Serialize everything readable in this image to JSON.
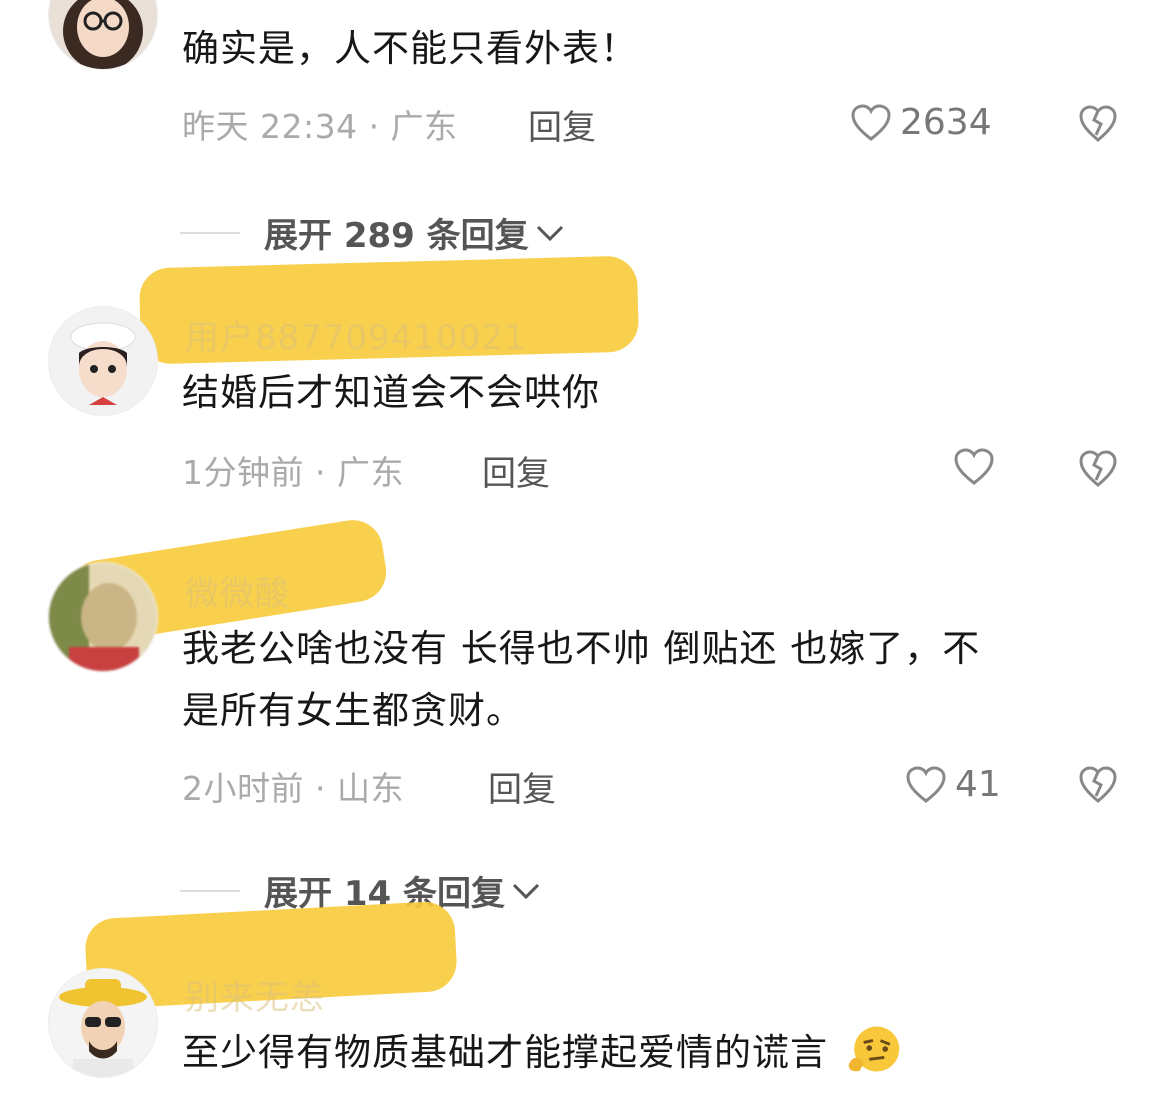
{
  "comments": [
    {
      "name": "",
      "text": "确实是，人不能只看外表！",
      "meta": "昨天 22:34 · 广东",
      "reply": "回复",
      "likes": "2634",
      "expand": "展开 289 条回复"
    },
    {
      "name": "用户887709410021",
      "text": "结婚后才知道会不会哄你",
      "meta": "1分钟前 · 广东",
      "reply": "回复",
      "likes": "",
      "expand": ""
    },
    {
      "name": "微微酸",
      "text_line1": "我老公啥也没有 长得也不帅 倒贴还 也嫁了，不",
      "text_line2": "是所有女生都贪财。",
      "meta": "2小时前 · 山东",
      "reply": "回复",
      "likes": "41",
      "expand": "展开 14 条回复"
    },
    {
      "name": "别来无恙",
      "text": "至少得有物质基础才能撑起爱情的谎言",
      "emoji": "thinking-face-icon"
    }
  ],
  "colors": {
    "highlight": "#f8cc3f",
    "meta": "#aaaaaa",
    "text": "#171717"
  }
}
